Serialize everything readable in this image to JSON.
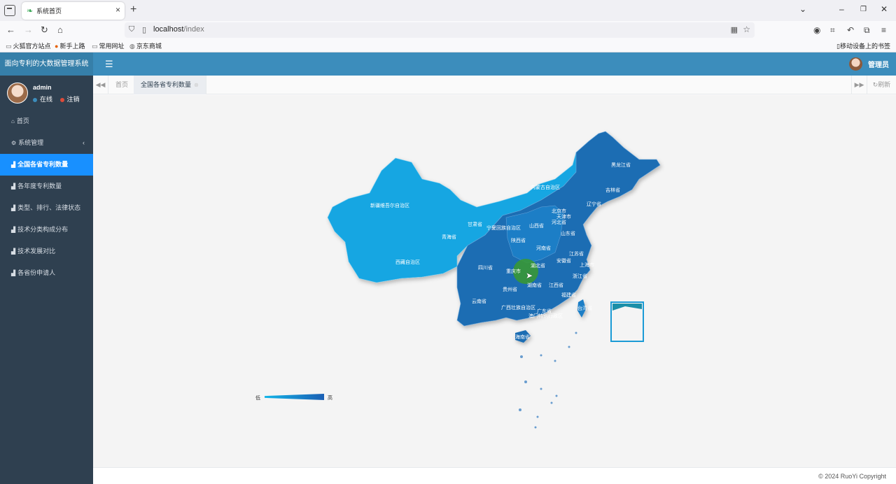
{
  "browser": {
    "tab_title": "系统首页",
    "url_host": "localhost",
    "url_path": "/index",
    "bookmarks": [
      "火狐官方站点",
      "新手上路",
      "常用网址",
      "京东商城"
    ],
    "bookmarks_right": "移动设备上的书签"
  },
  "app": {
    "logo": "面向专利的大数据管理系统",
    "user_role": "管理员",
    "user_name": "admin",
    "status_online": "在线",
    "status_logout": "注销"
  },
  "sidebar": {
    "items": [
      {
        "label": "首页",
        "icon": "home-icon"
      },
      {
        "label": "系统管理",
        "icon": "gear-icon"
      },
      {
        "label": "全国各省专利数量",
        "icon": "area-chart-icon",
        "active": true
      },
      {
        "label": "各年度专利数量",
        "icon": "area-chart-icon"
      },
      {
        "label": "类型、排行、法律状态",
        "icon": "area-chart-icon"
      },
      {
        "label": "技术分类构成分布",
        "icon": "area-chart-icon"
      },
      {
        "label": "技术发展对比",
        "icon": "area-chart-icon"
      },
      {
        "label": "各省份申请人",
        "icon": "area-chart-icon"
      }
    ]
  },
  "tabs": {
    "home": "首页",
    "active": "全国各省专利数量",
    "refresh": "刷新"
  },
  "map": {
    "provinces": [
      "黑龙江省",
      "吉林省",
      "辽宁省",
      "内蒙古自治区",
      "北京市",
      "天津市",
      "河北省",
      "新疆维吾尔自治区",
      "甘肃省",
      "宁夏回族自治区",
      "山西省",
      "山东省",
      "青海省",
      "陕西省",
      "河南省",
      "江苏省",
      "西藏自治区",
      "四川省",
      "重庆市",
      "湖北省",
      "安徽省",
      "上海市",
      "浙江省",
      "湖南省",
      "江西省",
      "云南省",
      "贵州省",
      "福建省",
      "广西壮族自治区",
      "广东省",
      "台湾省",
      "澳门特别行政区",
      "海南省"
    ],
    "highlighted": "湖北省",
    "visual_map": {
      "low": "低",
      "high": "高",
      "low_color": "#13b5e8",
      "high_color": "#1a5fb4"
    }
  },
  "footer": "© 2024 RuoYi Copyright"
}
